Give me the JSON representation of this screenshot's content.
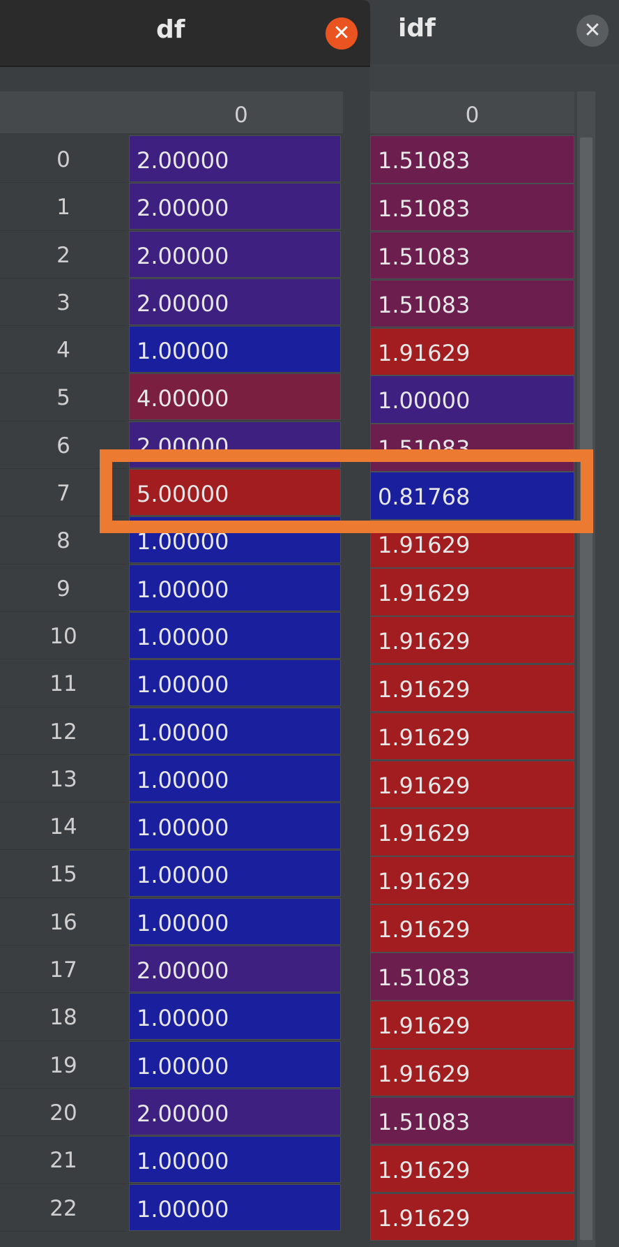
{
  "tabs": {
    "df": {
      "title": "df"
    },
    "idf": {
      "title": "idf"
    },
    "close_glyph": "✕"
  },
  "colors": {
    "high": "#a11d20",
    "midhigh": "#7b1f40",
    "mid": "#6c1f4f",
    "midlow": "#3e2080",
    "low": "#1a1f9e",
    "highlight": "#ec7a30",
    "close_active": "#e95420"
  },
  "df_table": {
    "column_header": "0",
    "rows": [
      {
        "index": "0",
        "value": "2.00000",
        "color": "#3e2080"
      },
      {
        "index": "1",
        "value": "2.00000",
        "color": "#3e2080"
      },
      {
        "index": "2",
        "value": "2.00000",
        "color": "#3e2080"
      },
      {
        "index": "3",
        "value": "2.00000",
        "color": "#3e2080"
      },
      {
        "index": "4",
        "value": "1.00000",
        "color": "#1a1f9e"
      },
      {
        "index": "5",
        "value": "4.00000",
        "color": "#7b1f40"
      },
      {
        "index": "6",
        "value": "2.00000",
        "color": "#3e2080"
      },
      {
        "index": "7",
        "value": "5.00000",
        "color": "#a11d20"
      },
      {
        "index": "8",
        "value": "1.00000",
        "color": "#1a1f9e"
      },
      {
        "index": "9",
        "value": "1.00000",
        "color": "#1a1f9e"
      },
      {
        "index": "10",
        "value": "1.00000",
        "color": "#1a1f9e"
      },
      {
        "index": "11",
        "value": "1.00000",
        "color": "#1a1f9e"
      },
      {
        "index": "12",
        "value": "1.00000",
        "color": "#1a1f9e"
      },
      {
        "index": "13",
        "value": "1.00000",
        "color": "#1a1f9e"
      },
      {
        "index": "14",
        "value": "1.00000",
        "color": "#1a1f9e"
      },
      {
        "index": "15",
        "value": "1.00000",
        "color": "#1a1f9e"
      },
      {
        "index": "16",
        "value": "1.00000",
        "color": "#1a1f9e"
      },
      {
        "index": "17",
        "value": "2.00000",
        "color": "#3e2080"
      },
      {
        "index": "18",
        "value": "1.00000",
        "color": "#1a1f9e"
      },
      {
        "index": "19",
        "value": "1.00000",
        "color": "#1a1f9e"
      },
      {
        "index": "20",
        "value": "2.00000",
        "color": "#3e2080"
      },
      {
        "index": "21",
        "value": "1.00000",
        "color": "#1a1f9e"
      },
      {
        "index": "22",
        "value": "1.00000",
        "color": "#1a1f9e"
      }
    ]
  },
  "idf_table": {
    "column_header": "0",
    "rows": [
      {
        "value": "1.51083",
        "color": "#6c1f4f"
      },
      {
        "value": "1.51083",
        "color": "#6c1f4f"
      },
      {
        "value": "1.51083",
        "color": "#6c1f4f"
      },
      {
        "value": "1.51083",
        "color": "#6c1f4f"
      },
      {
        "value": "1.91629",
        "color": "#a11d20"
      },
      {
        "value": "1.00000",
        "color": "#3e2080"
      },
      {
        "value": "1.51083",
        "color": "#6c1f4f"
      },
      {
        "value": "0.81768",
        "color": "#1a1f9e"
      },
      {
        "value": "1.91629",
        "color": "#a11d20"
      },
      {
        "value": "1.91629",
        "color": "#a11d20"
      },
      {
        "value": "1.91629",
        "color": "#a11d20"
      },
      {
        "value": "1.91629",
        "color": "#a11d20"
      },
      {
        "value": "1.91629",
        "color": "#a11d20"
      },
      {
        "value": "1.91629",
        "color": "#a11d20"
      },
      {
        "value": "1.91629",
        "color": "#a11d20"
      },
      {
        "value": "1.91629",
        "color": "#a11d20"
      },
      {
        "value": "1.91629",
        "color": "#a11d20"
      },
      {
        "value": "1.51083",
        "color": "#6c1f4f"
      },
      {
        "value": "1.91629",
        "color": "#a11d20"
      },
      {
        "value": "1.91629",
        "color": "#a11d20"
      },
      {
        "value": "1.51083",
        "color": "#6c1f4f"
      },
      {
        "value": "1.91629",
        "color": "#a11d20"
      },
      {
        "value": "1.91629",
        "color": "#a11d20"
      }
    ]
  }
}
